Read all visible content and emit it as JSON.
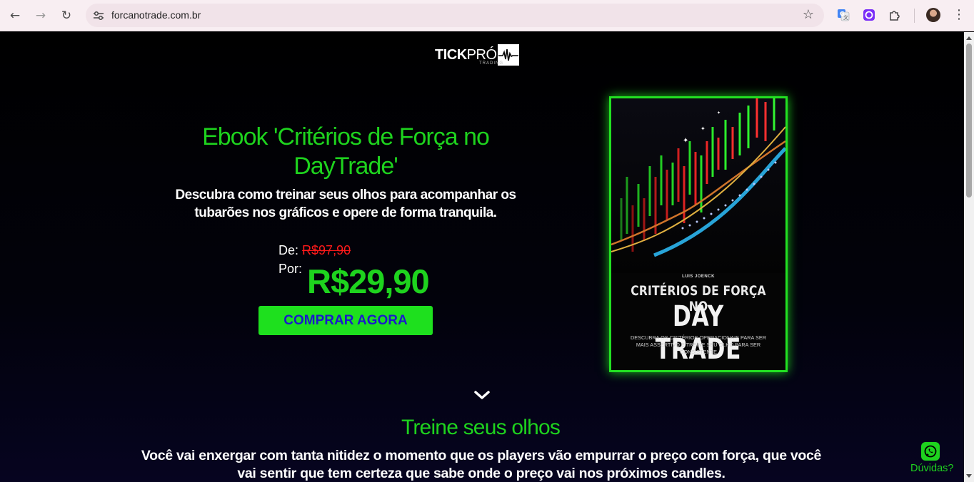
{
  "browser": {
    "url": "forcanotrade.com.br",
    "icons": [
      "back-arrow-icon",
      "forward-arrow-icon",
      "reload-icon",
      "site-info-icon",
      "bookmark-star-icon",
      "google-translate-icon",
      "extension-purple-icon",
      "extensions-puzzle-icon",
      "profile-avatar-icon",
      "menu-dots-icon"
    ]
  },
  "brand": {
    "logo_main": "TICK",
    "logo_secondary": "PRÓ",
    "logo_sub": "TRADING"
  },
  "hero": {
    "title": "Ebook 'Critérios de Força no DayTrade'",
    "subtitle": "Descubra como treinar seus olhos para acompanhar os tubarões nos gráficos e opere de forma tranquila.",
    "price_from_label": "De:",
    "price_old": "R$97,90",
    "price_por_label": "Por:",
    "price_new": "R$29,90",
    "cta_label": "COMPRAR AGORA"
  },
  "book_cover": {
    "author": "LUIS JOENCK",
    "title_line1": "CRITÉRIOS DE FORÇA NO",
    "title_line2": "DAY TRADE",
    "description": "DESCUBRA OS CRITÉRIOS OPERACIONAIS PARA SER MAIS ASSERTIVO E TREINE SEU OLHO PARA SER CONSISTENTE"
  },
  "section": {
    "title": "Treine seus olhos",
    "text": "Você vai enxergar com tanta nitidez o momento que os players vão empurrar o preço com força, que você vai sentir que tem certeza que sabe onde o preço vai nos próximos candles."
  },
  "whatsapp": {
    "label": "Dúvidas?"
  },
  "colors": {
    "accent_green": "#1ed31e",
    "old_price_red": "#ff1a1a",
    "cta_text_blue": "#1a1acb",
    "background": "#000000"
  }
}
